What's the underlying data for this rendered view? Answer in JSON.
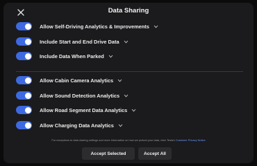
{
  "dialog": {
    "title": "Data Sharing",
    "close_icon": "close-icon"
  },
  "groups": {
    "driving": [
      {
        "label": "Allow Self-Driving Analytics & Improvements",
        "enabled": true
      },
      {
        "label": "Include Start and End Drive Data",
        "enabled": true
      },
      {
        "label": "Include Data When Parked",
        "enabled": true
      }
    ],
    "other": [
      {
        "label": "Allow Cabin Camera Analytics",
        "enabled": true
      },
      {
        "label": "Allow Sound Detection Analytics",
        "enabled": true
      },
      {
        "label": "Allow Road Segment Data Analytics",
        "enabled": true
      },
      {
        "label": "Allow Charging Data Analytics",
        "enabled": true
      }
    ]
  },
  "footnote": {
    "text": "For exceptions to data sharing settings and more information on how we protect your data, view Tesla's ",
    "link": "Customer Privacy Notice"
  },
  "buttons": {
    "accept_selected": "Accept Selected",
    "accept_all": "Accept All"
  },
  "colors": {
    "toggle_on": "#3e6ae1",
    "dialog_bg": "#1b1b1d",
    "link": "#6e95ff"
  }
}
